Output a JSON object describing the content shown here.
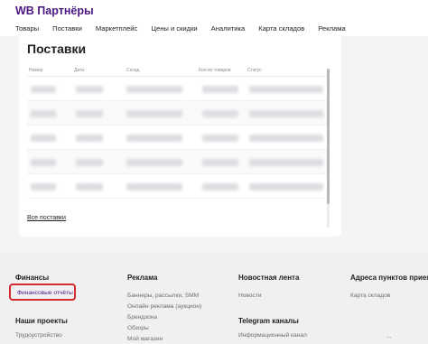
{
  "brand": "WB Партнёры",
  "nav": [
    "Товары",
    "Поставки",
    "Маркетплейс",
    "Цены и скидки",
    "Аналитика",
    "Карта складов",
    "Реклама"
  ],
  "card": {
    "title": "Поставки",
    "columns": [
      "Номер",
      "Дата",
      "Склад",
      "Кол-во товаров",
      "Статус"
    ],
    "all_link": "Все поставки"
  },
  "footer": {
    "finance": {
      "title": "Финансы",
      "link": "Финансовые отчёты"
    },
    "projects": {
      "title": "Наши проекты",
      "links": [
        "Трудоустройство"
      ]
    },
    "ads": {
      "title": "Реклама",
      "links": [
        "Баннеры, рассылки, SMM",
        "Онлайн реклама (аукцион)",
        "Брендзона",
        "Обзоры",
        "Мой магазин"
      ]
    },
    "news": {
      "title": "Новостная лента",
      "links": [
        "Новости"
      ]
    },
    "telegram": {
      "title": "Telegram каналы",
      "links": [
        "Информационный канал",
        "..."
      ]
    },
    "pickup": {
      "title": "Адреса пунктов приема",
      "links": [
        "Карта складов"
      ]
    }
  },
  "colors": {
    "brand": "#4b1780",
    "highlight": "#d42c2c"
  }
}
